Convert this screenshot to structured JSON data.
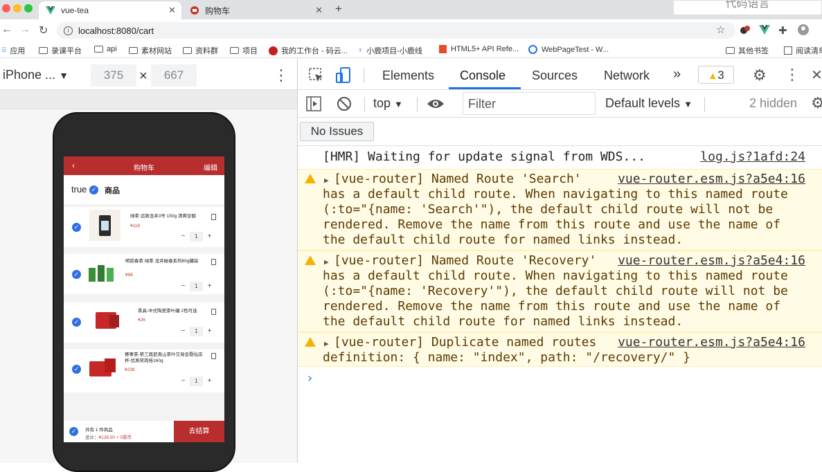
{
  "browser": {
    "tabs": [
      {
        "label": "vue-tea",
        "active": true
      },
      {
        "label": "购物车",
        "active": false
      }
    ],
    "floating_text": "代码语言",
    "url": "localhost:8080/cart",
    "bookmarks": [
      "应用",
      "录课平台",
      "api",
      "素材网站",
      "资料群",
      "项目",
      "我的工作台 - 码云...",
      "小鹿项目-小鹿线",
      "HTML5+ API Refe...",
      "WebPageTest - W...",
      "其他书签",
      "阅读清单"
    ]
  },
  "device_toolbar": {
    "device": "iPhone ...",
    "width": "375",
    "height": "667"
  },
  "app": {
    "header": {
      "back": "‹",
      "title": "购物车",
      "edit": "编辑"
    },
    "select_all_text": "true",
    "goods_label": "商品",
    "items": [
      {
        "name": "绿茶 远致龙井3号 150g 清爽甘醇",
        "price": "¥118",
        "qty": "1"
      },
      {
        "name": "明前春茶 绿茶 龙井破春系列80g罐装",
        "price": "¥98",
        "qty": "1"
      },
      {
        "name": "茶具-中式陶瓷茶叶罐 2色可选",
        "price": "¥26",
        "qty": "1"
      },
      {
        "name": "赛事茶-第三届武夷山茶叶交易会暨仙店杯-优质奖肉桂160g",
        "price": "¥238",
        "qty": "1"
      }
    ],
    "footer": {
      "count": "共有 1 件商品",
      "total_label": "总计：",
      "total_value": "¥128.00 + 0茶币",
      "checkout": "去结算"
    }
  },
  "devtools": {
    "tabs": [
      "Elements",
      "Console",
      "Sources",
      "Network"
    ],
    "more": "»",
    "warn_count": "3",
    "context": "top",
    "filter_placeholder": "Filter",
    "levels": "Default levels",
    "hidden": "2 hidden",
    "no_issues": "No Issues",
    "messages": [
      {
        "type": "log",
        "lines": [
          "[HMR] Waiting for update signal from WDS..."
        ],
        "source": "log.js?1afd:24"
      },
      {
        "type": "warn",
        "lines": [
          "[vue-router] Named Route 'Search'",
          "has a default child route. When navigating to this named route",
          "(:to=\"{name: 'Search'\"), the default child route will not be",
          "rendered. Remove the name from this route and use the name of",
          "the default child route for named links instead."
        ],
        "source": "vue-router.esm.js?a5e4:16"
      },
      {
        "type": "warn",
        "lines": [
          "[vue-router] Named Route 'Recovery'",
          "has a default child route. When navigating to this named route",
          "(:to=\"{name: 'Recovery'\"), the default child route will not be",
          "rendered. Remove the name from this route and use the name of",
          "the default child route for named links instead."
        ],
        "source": "vue-router.esm.js?a5e4:16"
      },
      {
        "type": "warn",
        "lines": [
          "[vue-router] Duplicate named routes",
          "definition: { name: \"index\", path: \"/recovery/\" }"
        ],
        "source": "vue-router.esm.js?a5e4:16"
      }
    ],
    "prompt": "›"
  }
}
